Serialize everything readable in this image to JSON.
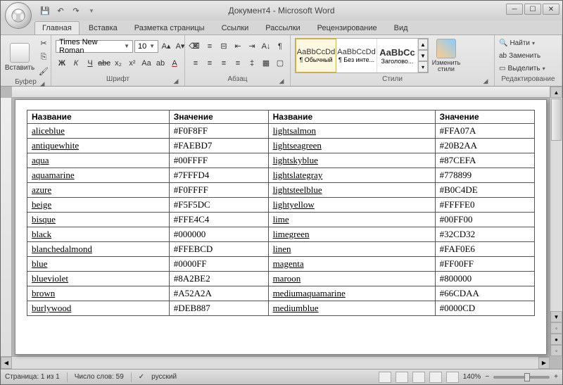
{
  "window": {
    "title": "Документ4 - Microsoft Word"
  },
  "tabs": [
    "Главная",
    "Вставка",
    "Разметка страницы",
    "Ссылки",
    "Рассылки",
    "Рецензирование",
    "Вид"
  ],
  "ribbon": {
    "clipboard": {
      "paste": "Вставить",
      "label": "Буфер обмена"
    },
    "font": {
      "name": "Times New Roman",
      "size": "10",
      "label": "Шрифт"
    },
    "paragraph": {
      "label": "Абзац"
    },
    "styles": {
      "label": "Стили",
      "change": "Изменить стили",
      "items": [
        {
          "sample": "AaBbCcDd",
          "name": "¶ Обычный"
        },
        {
          "sample": "AaBbCcDd",
          "name": "¶ Без инте..."
        },
        {
          "sample": "AaBbCc",
          "name": "Заголово..."
        }
      ]
    },
    "editing": {
      "label": "Редактирование",
      "find": "Найти",
      "replace": "Заменить",
      "select": "Выделить"
    }
  },
  "table": {
    "headers": [
      "Название",
      "Значение",
      "Название",
      "Значение"
    ],
    "rows": [
      [
        "aliceblue",
        "#F0F8FF",
        "lightsalmon",
        "#FFA07A"
      ],
      [
        "antiquewhite",
        "#FAEBD7",
        "lightseagreen",
        "#20B2AA"
      ],
      [
        "aqua",
        "#00FFFF",
        "lightskyblue",
        "#87CEFA"
      ],
      [
        "aquamarine",
        "#7FFFD4",
        "lightslategray",
        "#778899"
      ],
      [
        "azure",
        "#F0FFFF",
        "lightsteelblue",
        "#B0C4DE"
      ],
      [
        "beige",
        "#F5F5DC",
        "lightyellow",
        "#FFFFE0"
      ],
      [
        "bisque",
        "#FFE4C4",
        "lime",
        "#00FF00"
      ],
      [
        "black",
        "#000000",
        "limegreen",
        "#32CD32"
      ],
      [
        "blanchedalmond",
        "#FFEBCD",
        "linen",
        "#FAF0E6"
      ],
      [
        "blue",
        "#0000FF",
        "magenta",
        "#FF00FF"
      ],
      [
        "blueviolet",
        "#8A2BE2",
        "maroon",
        "#800000"
      ],
      [
        "brown",
        "#A52A2A",
        "mediumaquamarine",
        "#66CDAA"
      ],
      [
        "burlywood",
        "#DEB887",
        "mediumblue",
        "#0000CD"
      ]
    ]
  },
  "status": {
    "page": "Страница: 1 из 1",
    "words": "Число слов: 59",
    "lang": "русский",
    "zoom": "140%"
  }
}
